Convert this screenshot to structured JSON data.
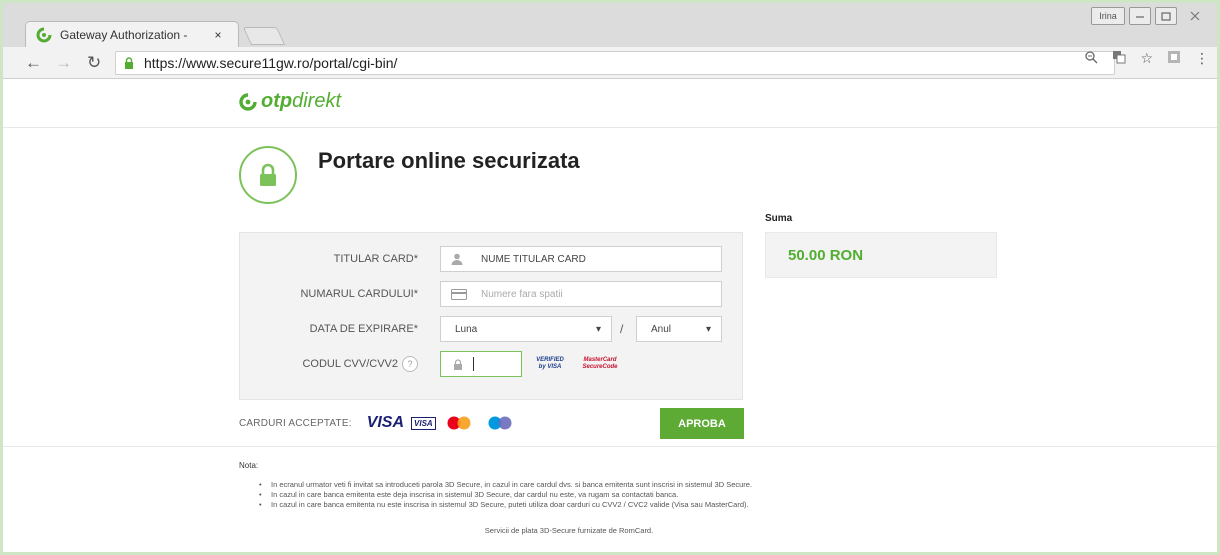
{
  "browser": {
    "tab_title": "Gateway Authorization -",
    "tab_close": "×",
    "window_user": "Irina",
    "url": "https://www.secure11gw.ro/portal/cgi-bin/"
  },
  "brand": {
    "logo_otp": "otp",
    "logo_direkt": "direkt",
    "accent_color": "#52ae30"
  },
  "page": {
    "title": "Portare online securizata"
  },
  "form": {
    "holder_label": "TITULAR CARD*",
    "holder_value": "NUME TITULAR CARD",
    "number_label": "NUMARUL CARDULUI*",
    "number_placeholder": "Numere fara spatii",
    "expiry_label": "DATA DE EXPIRARE*",
    "month_value": "Luna",
    "year_value": "Anul",
    "slash": "/",
    "cvv_label": "CODUL CVV/CVV2",
    "help": "?",
    "verified_by_visa": "VERIFIED by VISA",
    "mastercard_securecode": "MasterCard SecureCode"
  },
  "summary": {
    "label": "Suma",
    "amount": "50.00 RON"
  },
  "accepted_cards": {
    "label": "CARDURI ACCEPTATE:",
    "visa": "VISA",
    "visa_small": "VISA"
  },
  "actions": {
    "approve": "APROBA"
  },
  "notes": {
    "title": "Nota:",
    "items": [
      "In ecranul urmator veti fi invitat sa introduceti parola 3D Secure, in cazul in care cardul dvs. si banca emitenta sunt inscrisi in sistemul 3D Secure.",
      "In cazul in care banca emitenta este deja inscrisa in sistemul 3D Secure, dar cardul nu este, va rugam sa contactati banca.",
      "In cazul in care banca emitenta nu este inscrisa in sistemul 3D Secure, puteti utiliza doar carduri cu CVV2 / CVC2 valide (Visa sau MasterCard)."
    ],
    "footer": "Servicii de plata 3D-Secure furnizate de RomCard."
  }
}
